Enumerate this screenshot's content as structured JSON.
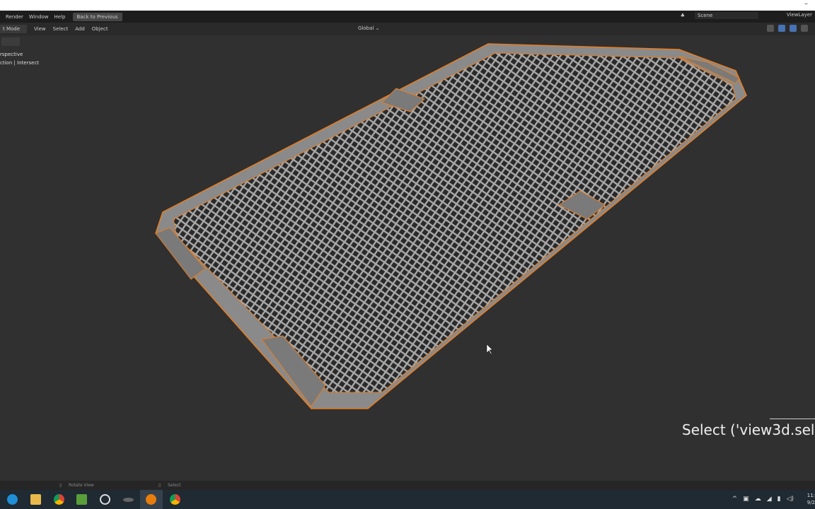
{
  "menubar": {
    "items": [
      "Render",
      "Window",
      "Help"
    ],
    "back_button": "Back to Previous",
    "scene": "Scene",
    "view_layer": "ViewLayer"
  },
  "header": {
    "mode": "t Mode",
    "menus": [
      "View",
      "Select",
      "Add",
      "Object"
    ],
    "orientation": "Global"
  },
  "overlay": {
    "line1": "rspective",
    "line2": "ction | Intersect"
  },
  "operator_info": "Select ('view3d.sel",
  "statusbar": {
    "left": "Rotate View",
    "mid": "Select"
  },
  "clock": {
    "time": "11:",
    "date": "9/2"
  },
  "colors": {
    "selection": "#e87d20",
    "bg": "#303030",
    "mesh": "#9a9a9a"
  }
}
